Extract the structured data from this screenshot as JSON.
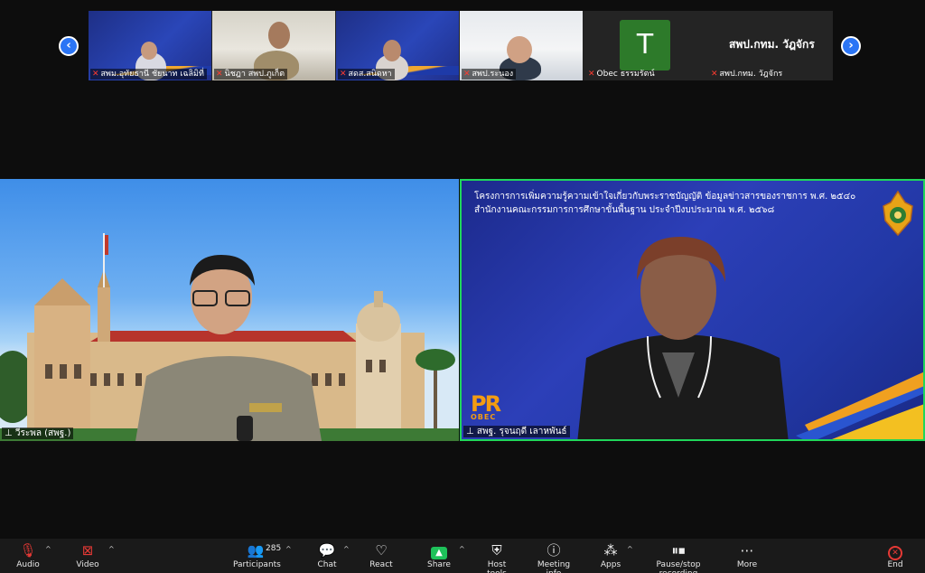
{
  "strip": {
    "prev_icon": "‹",
    "next_icon": "›",
    "tiles": [
      {
        "name": "สพม.อุทัยธานี ชัยนาท เฉลิมิที่"
      },
      {
        "name": "นิชฎา สพป.ภูเก็ต"
      },
      {
        "name": "สดส.สนิดหา"
      },
      {
        "name": "สพป.ระนอง"
      },
      {
        "name": "Obec ธรรมรัตน์"
      },
      {
        "name": "สพป.กทม. วัฎจักร",
        "avatar_letter": "T",
        "big_name": "สพป.กทม. วัฎจักร"
      }
    ]
  },
  "main": {
    "left_name": "วีระพล (สพฐ.)",
    "right_name": "สพฐ. รุจนฤดี เลาหพันธ์",
    "right_banner": {
      "line1": "โครงการการเพิ่มความรู้ความเข้าใจเกี่ยวกับพระราชบัญญัติ ข้อมูลข่าวสารของราชการ พ.ศ. ๒๕๔๐",
      "line2": "สำนักงานคณะกรรมการการศึกษาขั้นพื้นฐาน ประจำปีงบประมาณ พ.ศ. ๒๕๖๘",
      "logo_text": "PR",
      "logo_sub": "OBEC"
    }
  },
  "toolbar": {
    "audio": "Audio",
    "video": "Video",
    "participants": "Participants",
    "participants_count": "285",
    "chat": "Chat",
    "react": "React",
    "share": "Share",
    "host_tools": "Host tools",
    "meeting_info": "Meeting info",
    "apps": "Apps",
    "recording": "Pause/stop recording",
    "more": "More",
    "end": "End"
  },
  "colors": {
    "active_speaker_border": "#20d65a",
    "share_green": "#1ec15a",
    "end_red": "#e53935",
    "nav_blue": "#2b75f5"
  }
}
